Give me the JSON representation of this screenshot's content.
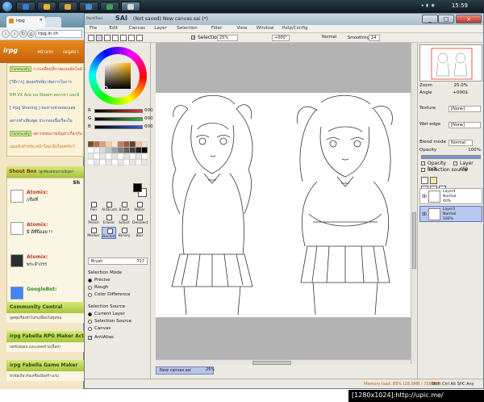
{
  "taskbar": {
    "clock": "15:59",
    "items": [
      {
        "icon": "ie-icon",
        "color": "#3a7bd5"
      },
      {
        "icon": "chrome-icon",
        "color": "#e8b22a"
      },
      {
        "icon": "folder-icon",
        "color": "#e0a93a"
      },
      {
        "icon": "windows-icon",
        "color": "#4a8fd4"
      },
      {
        "icon": "media-icon",
        "color": "#3fa34d"
      },
      {
        "icon": "sai-icon",
        "color": "#d9d9d9"
      }
    ]
  },
  "browser": {
    "tab_label": "irpg",
    "tab_close": "×",
    "url": "irpg.in.th",
    "logo": "irpg",
    "nav": [
      "หน้าแรก",
      "เมนูสมา"
    ],
    "news": [
      {
        "tag": "Community",
        "text": "การเคลื่อนที่ภาพแบบอัตโนมัติ",
        "color": "red"
      },
      {
        "tag": "",
        "text": "[วิธีการ] สุ่มสคริปท์มาจัดการในการ",
        "color": "blue"
      },
      {
        "tag": "",
        "text": "RM VX Ace บน Steam ลดราคา และมี",
        "color": "green"
      },
      {
        "tag": "",
        "text": "[ irpg Sharing ] ขอท่านช่วยตอบเลย",
        "color": "blue"
      },
      {
        "tag": "",
        "text": "อยากทำเสียงพูด ประกอบเนื้อเรื่องใน",
        "color": "blue"
      },
      {
        "tag": "Community",
        "text": "อยากสอบถามปัญหาเกี่ยวกับ",
        "color": "red"
      },
      {
        "tag": "",
        "text": "แผนข้าสำหรับ หน้าใหม่ มือใหม่ครับ!!",
        "color": "orange"
      }
    ],
    "shoutbox_title": "Shout Box",
    "shoutbox_sub": "(ลูกค้องสอบถามปัญหา",
    "shoutbox_label": "Sh",
    "posts": [
      {
        "name": "Atomix:",
        "text": "//ถือที่",
        "color": "red"
      },
      {
        "name": "Atomix:",
        "text": "มี ดีที่ปีออย !!",
        "color": "red"
      },
      {
        "name": "Atomix:",
        "text": "พระจำกรร",
        "color": "red"
      },
      {
        "name": "GoogleBot:",
        "text": "",
        "color": "green"
      }
    ],
    "sections": [
      {
        "title": "Community Central",
        "body": "พูดคุยเรื่องทั่วไปกับเพื่อนในชุมชน"
      },
      {
        "title": "irpg Fabella RPG Maker Act",
        "body": "บทช่วยสอน และแหล่งรวมเนื้อหา"
      },
      {
        "title": "irpg Fabella Game Maker",
        "body": "หัวข้อเกี่ยวกับเครื่องมือสร้างเกม"
      }
    ]
  },
  "sai": {
    "title": "(Not saved) New canvas.sai (*)",
    "app": "SAI",
    "app_prefix": "PaintTool",
    "window_buttons": [
      "_",
      "□",
      "×"
    ],
    "menu": [
      "File",
      "Edit",
      "Canvas",
      "Layer",
      "Selection",
      "Filter",
      "View",
      "Window",
      "Help/Config"
    ],
    "toolbar": {
      "selection_label": "Selection",
      "zoom": "25%",
      "angle": "+000°",
      "mode": "Normal",
      "smoothing_label": "Smoothing",
      "smoothing_value": "14"
    },
    "sliders": [
      {
        "label": "R",
        "value": "000",
        "color": "#e03a3a"
      },
      {
        "label": "G",
        "value": "000",
        "color": "#3ab04a"
      },
      {
        "label": "B",
        "value": "000",
        "color": "#3a5ae0"
      }
    ],
    "tools": [
      {
        "name": "Pen"
      },
      {
        "name": "AirBrush"
      },
      {
        "name": "Brush"
      },
      {
        "name": "Water"
      },
      {
        "name": "Pencil"
      },
      {
        "name": "Eraser"
      },
      {
        "name": "Select"
      },
      {
        "name": "Deselect"
      },
      {
        "name": "Marker"
      },
      {
        "name": "Bucket"
      },
      {
        "name": "Binary"
      },
      {
        "name": "Blur"
      }
    ],
    "selected_tool": "Bucket",
    "brush_field_label": "Brush",
    "brush_field_value": "717",
    "selection_mode_label": "Selection Mode",
    "selection_modes": [
      {
        "label": "Precise",
        "on": true
      },
      {
        "label": "Rough",
        "on": false
      },
      {
        "label": "Color Difference",
        "on": false
      }
    ],
    "selection_source_label": "Selection Source",
    "selection_sources": [
      {
        "label": "Current Layer",
        "on": true
      },
      {
        "label": "Selection Source",
        "on": false
      },
      {
        "label": "Canvas",
        "on": false
      }
    ],
    "antialias_label": "AntiAlias",
    "doc_tab": "New canvas.sai",
    "doc_zoom": "25%",
    "navigator": {
      "zoom_label": "Zoom",
      "zoom_value": "25.0%",
      "angle_label": "Angle",
      "angle_value": "+000$"
    },
    "texture_label": "Texture",
    "texture_value": "[None]",
    "wet_edge_label": "Wet edge",
    "wet_edge_value": "[None]",
    "blend_mode_label": "Blend mode",
    "blend_mode_value": "Normal",
    "opacity_label": "Opacity",
    "opacity_value": "100%",
    "opacity_fill": 1.0,
    "opacity_lock_label": "Opacity lock",
    "layer_clip_label": "Layer clip",
    "selection_source_chk": "Selection source",
    "layers": [
      {
        "name": "Layer4",
        "mode": "Normal",
        "opacity": "40%",
        "selected": false
      },
      {
        "name": "Layer1",
        "mode": "Normal",
        "opacity": "100%",
        "selected": true
      }
    ],
    "status_memory": "Memory load: 85% (28.0MB / 759MB)",
    "status_keys": "Shift Ctrl Alt SPC Any"
  },
  "watermark": "[1280x1024]:http://upic.me/"
}
